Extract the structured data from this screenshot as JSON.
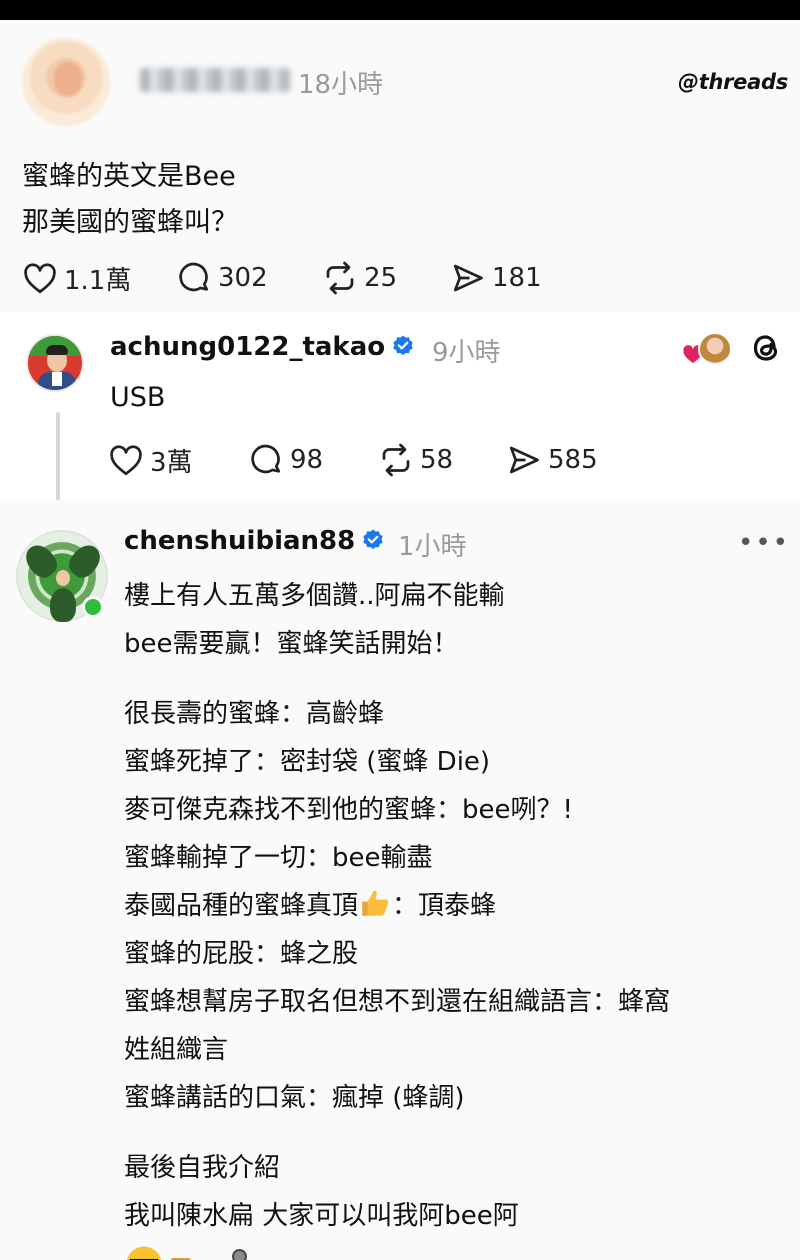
{
  "post": {
    "time": "18小時",
    "brand": "@threads",
    "lines": [
      "蜜蜂的英文是Bee",
      "那美國的蜜蜂叫？"
    ],
    "stats": {
      "likes": "1.1萬",
      "comments": "302",
      "reposts": "25",
      "shares": "181"
    }
  },
  "reply": {
    "username": "achung0122_takao",
    "time": "9小時",
    "text": "USB",
    "stats": {
      "likes": "3萬",
      "comments": "98",
      "reposts": "58",
      "shares": "585"
    }
  },
  "reply2": {
    "username": "chenshuibian88",
    "time": "1小時",
    "more": "•••",
    "lines": [
      "樓上有人五萬多個讚..阿扁不能輸",
      "bee需要贏！蜜蜂笑話開始！"
    ],
    "jokes": [
      "很長壽的蜜蜂：高齡蜂",
      "蜜蜂死掉了：密封袋 (蜜蜂 Die)",
      "麥可傑克森找不到他的蜜蜂：bee咧？!",
      "蜜蜂輸掉了一切：bee輸盡",
      "蜜蜂的屁股：蜂之股",
      "蜜蜂想幫房子取名但想不到還在組織語言：蜂窩",
      "姓組織言",
      "蜜蜂講話的口氣：瘋掉 (蜂調)"
    ],
    "thai_joke_a": "泰國品種的蜜蜂真頂",
    "thai_joke_b": "：頂泰蜂",
    "outro": [
      "最後自我介紹",
      "我叫陳水扁 大家可以叫我阿bee阿"
    ]
  },
  "icons": [
    "heart-icon",
    "comment-icon",
    "repost-icon",
    "share-icon",
    "verified-icon",
    "threads-icon",
    "thumbs-up-icon",
    "sunglasses-emoji-icon",
    "pointing-hand-icon",
    "microphone-icon"
  ],
  "colors": {
    "verified": "#1877f2",
    "online": "#2fbb3c",
    "like_red": "#e0245e"
  }
}
